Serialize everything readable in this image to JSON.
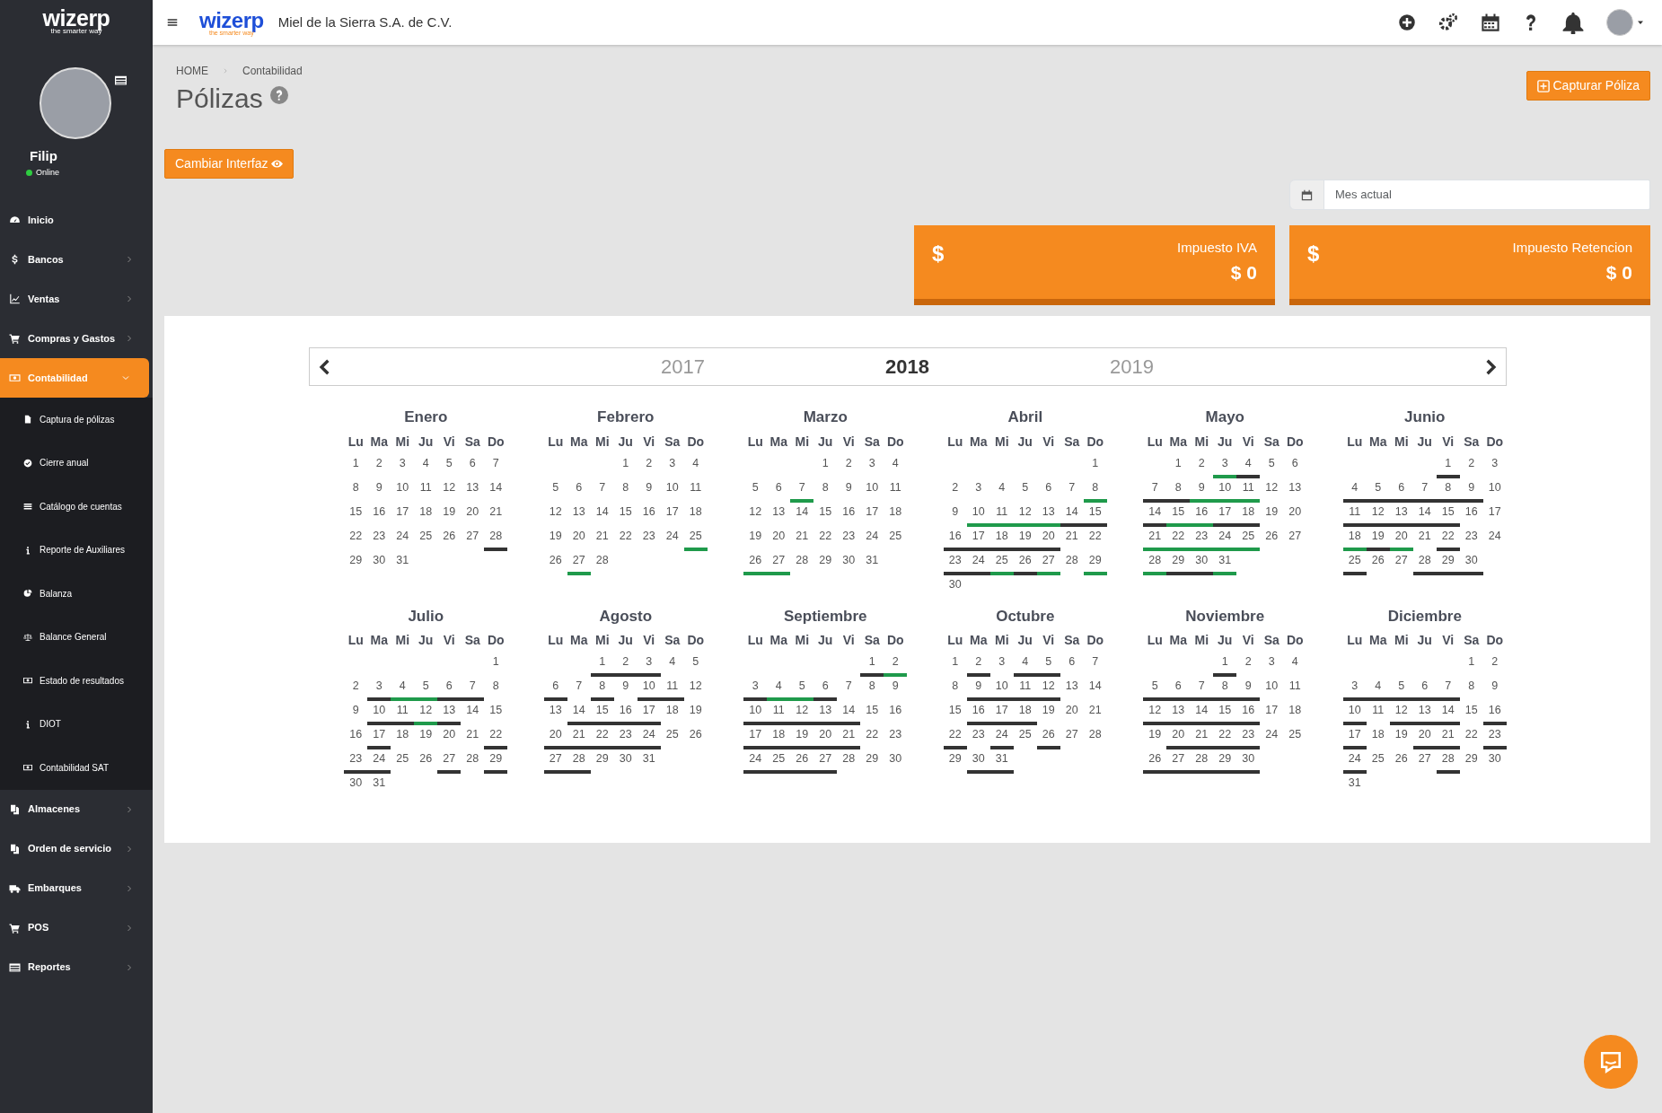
{
  "sidebar": {
    "logo": {
      "name": "wizerp",
      "tagline": "the smarter way"
    },
    "user": {
      "name": "Filip",
      "status": "Online"
    },
    "items": [
      {
        "label": "Inicio",
        "expandable": false,
        "selected": false
      },
      {
        "label": "Bancos",
        "expandable": true,
        "expanded": false,
        "selected": false
      },
      {
        "label": "Ventas",
        "expandable": true,
        "expanded": false,
        "selected": false
      },
      {
        "label": "Compras y Gastos",
        "expandable": true,
        "expanded": false,
        "selected": false
      },
      {
        "label": "Contabilidad",
        "expandable": true,
        "expanded": true,
        "selected": true,
        "children": [
          {
            "label": "Captura de pólizas"
          },
          {
            "label": "Cierre anual"
          },
          {
            "label": "Catálogo de cuentas"
          },
          {
            "label": "Reporte de Auxiliares"
          },
          {
            "label": "Balanza"
          },
          {
            "label": "Balance General"
          },
          {
            "label": "Estado de resultados"
          },
          {
            "label": "DIOT"
          },
          {
            "label": "Contabilidad SAT"
          }
        ]
      },
      {
        "label": "Almacenes",
        "expandable": true,
        "expanded": false,
        "selected": false
      },
      {
        "label": "Orden de servicio",
        "expandable": true,
        "expanded": false,
        "selected": false
      },
      {
        "label": "Embarques",
        "expandable": true,
        "expanded": false,
        "selected": false
      },
      {
        "label": "POS",
        "expandable": true,
        "expanded": false,
        "selected": false
      },
      {
        "label": "Reportes",
        "expandable": true,
        "expanded": false,
        "selected": false
      }
    ]
  },
  "topbar": {
    "logo": {
      "name": "wizerp",
      "tagline": "the smarter way"
    },
    "company": "Miel de la Sierra S.A. de C.V."
  },
  "breadcrumb": [
    "HOME",
    "Contabilidad"
  ],
  "page_title": "Pólizas",
  "buttons": {
    "capture": "Capturar Póliza",
    "switch": "Cambiar Interfaz"
  },
  "period_field": {
    "placeholder": "Mes actual"
  },
  "stats": [
    {
      "symbol": "$",
      "label": "Impuesto IVA",
      "value": "$ 0"
    },
    {
      "symbol": "$",
      "label": "Impuesto Retencion",
      "value": "$ 0"
    }
  ],
  "years": [
    {
      "label": "2017",
      "selected": false
    },
    {
      "label": "2018",
      "selected": true
    },
    {
      "label": "2019",
      "selected": false
    }
  ],
  "months": [
    {
      "name": "Enero",
      "weekdays": [
        "Lu",
        "Ma",
        "Mi",
        "Ju",
        "Vi",
        "Sa",
        "Do"
      ],
      "weeks": [
        [
          {
            "day": "1"
          },
          {
            "day": "2"
          },
          {
            "day": "3"
          },
          {
            "day": "4"
          },
          {
            "day": "5"
          },
          {
            "day": "6"
          },
          {
            "day": "7"
          }
        ],
        [
          {
            "day": "8"
          },
          {
            "day": "9"
          },
          {
            "day": "10"
          },
          {
            "day": "11"
          },
          {
            "day": "12"
          },
          {
            "day": "13"
          },
          {
            "day": "14"
          }
        ],
        [
          {
            "day": "15"
          },
          {
            "day": "16"
          },
          {
            "day": "17"
          },
          {
            "day": "18"
          },
          {
            "day": "19"
          },
          {
            "day": "20"
          },
          {
            "day": "21"
          }
        ],
        [
          {
            "day": "22"
          },
          {
            "day": "23"
          },
          {
            "day": "24"
          },
          {
            "day": "25"
          },
          {
            "day": "26"
          },
          {
            "day": "27"
          },
          {
            "day": "28",
            "color": "#333333"
          }
        ],
        [
          {
            "day": "29"
          },
          {
            "day": "30"
          },
          {
            "day": "31"
          }
        ]
      ]
    },
    {
      "name": "Febrero",
      "weekdays": [
        "Lu",
        "Ma",
        "Mi",
        "Ju",
        "Vi",
        "Sa",
        "Do"
      ],
      "weeks": [
        [
          {
            "day": "1"
          },
          {
            "day": "2"
          },
          {
            "day": "3"
          },
          {
            "day": "4"
          }
        ],
        [
          {
            "day": "5"
          },
          {
            "day": "6"
          },
          {
            "day": "7"
          },
          {
            "day": "8"
          },
          {
            "day": "9"
          },
          {
            "day": "10"
          },
          {
            "day": "11"
          }
        ],
        [
          {
            "day": "12"
          },
          {
            "day": "13"
          },
          {
            "day": "14"
          },
          {
            "day": "15"
          },
          {
            "day": "16"
          },
          {
            "day": "17"
          },
          {
            "day": "18"
          }
        ],
        [
          {
            "day": "19"
          },
          {
            "day": "20"
          },
          {
            "day": "21"
          },
          {
            "day": "22"
          },
          {
            "day": "23"
          },
          {
            "day": "24"
          },
          {
            "day": "25",
            "color": "#1f9a4b"
          }
        ],
        [
          {
            "day": "26"
          },
          {
            "day": "27",
            "color": "#1f9a4b"
          },
          {
            "day": "28"
          }
        ]
      ]
    },
    {
      "name": "Marzo",
      "weekdays": [
        "Lu",
        "Ma",
        "Mi",
        "Ju",
        "Vi",
        "Sa",
        "Do"
      ],
      "weeks": [
        [
          {
            "day": "1"
          },
          {
            "day": "2"
          },
          {
            "day": "3"
          },
          {
            "day": "4"
          }
        ],
        [
          {
            "day": "5"
          },
          {
            "day": "6"
          },
          {
            "day": "7",
            "color": "#1f9a4b"
          },
          {
            "day": "8"
          },
          {
            "day": "9"
          },
          {
            "day": "10"
          },
          {
            "day": "11"
          }
        ],
        [
          {
            "day": "12"
          },
          {
            "day": "13"
          },
          {
            "day": "14"
          },
          {
            "day": "15"
          },
          {
            "day": "16"
          },
          {
            "day": "17"
          },
          {
            "day": "18"
          }
        ],
        [
          {
            "day": "19"
          },
          {
            "day": "20"
          },
          {
            "day": "21"
          },
          {
            "day": "22"
          },
          {
            "day": "23"
          },
          {
            "day": "24"
          },
          {
            "day": "25"
          }
        ],
        [
          {
            "day": "26",
            "color": "#1f9a4b"
          },
          {
            "day": "27",
            "color": "#1f9a4b"
          },
          {
            "day": "28"
          },
          {
            "day": "29"
          },
          {
            "day": "30"
          },
          {
            "day": "31"
          }
        ]
      ]
    },
    {
      "name": "Abril",
      "weekdays": [
        "Lu",
        "Ma",
        "Mi",
        "Ju",
        "Vi",
        "Sa",
        "Do"
      ],
      "weeks": [
        [
          {
            "day": "1"
          }
        ],
        [
          {
            "day": "2"
          },
          {
            "day": "3"
          },
          {
            "day": "4"
          },
          {
            "day": "5"
          },
          {
            "day": "6"
          },
          {
            "day": "7"
          },
          {
            "day": "8",
            "color": "#1f9a4b"
          }
        ],
        [
          {
            "day": "9"
          },
          {
            "day": "10",
            "color": "#1f9a4b"
          },
          {
            "day": "11",
            "color": "#1f9a4b"
          },
          {
            "day": "12",
            "color": "#1f9a4b"
          },
          {
            "day": "13",
            "color": "#1f9a4b"
          },
          {
            "day": "14",
            "color": "#333333"
          },
          {
            "day": "15",
            "color": "#333333"
          }
        ],
        [
          {
            "day": "16",
            "color": "#333333"
          },
          {
            "day": "17",
            "color": "#333333"
          },
          {
            "day": "18",
            "color": "#333333"
          },
          {
            "day": "19",
            "color": "#333333"
          },
          {
            "day": "20",
            "color": "#333333"
          },
          {
            "day": "21"
          },
          {
            "day": "22"
          }
        ],
        [
          {
            "day": "23",
            "color": "#333333"
          },
          {
            "day": "24",
            "color": "#333333"
          },
          {
            "day": "25",
            "color": "#1f9a4b"
          },
          {
            "day": "26",
            "color": "#333333"
          },
          {
            "day": "27",
            "color": "#1f9a4b"
          },
          {
            "day": "28"
          },
          {
            "day": "29",
            "color": "#1f9a4b"
          }
        ],
        [
          {
            "day": "30"
          }
        ]
      ]
    },
    {
      "name": "Mayo",
      "weekdays": [
        "Lu",
        "Ma",
        "Mi",
        "Ju",
        "Vi",
        "Sa",
        "Do"
      ],
      "weeks": [
        [
          {
            "day": "1"
          },
          {
            "day": "2"
          },
          {
            "day": "3",
            "color": "#1f9a4b"
          },
          {
            "day": "4",
            "color": "#333333"
          },
          {
            "day": "5"
          },
          {
            "day": "6"
          }
        ],
        [
          {
            "day": "7",
            "color": "#333333"
          },
          {
            "day": "8",
            "color": "#333333"
          },
          {
            "day": "9",
            "color": "#1f9a4b"
          },
          {
            "day": "10",
            "color": "#1f9a4b"
          },
          {
            "day": "11",
            "color": "#1f9a4b"
          },
          {
            "day": "12"
          },
          {
            "day": "13"
          }
        ],
        [
          {
            "day": "14",
            "color": "#333333"
          },
          {
            "day": "15",
            "color": "#1f9a4b"
          },
          {
            "day": "16",
            "color": "#1f9a4b"
          },
          {
            "day": "17",
            "color": "#333333"
          },
          {
            "day": "18",
            "color": "#333333"
          },
          {
            "day": "19"
          },
          {
            "day": "20"
          }
        ],
        [
          {
            "day": "21",
            "color": "#1f9a4b"
          },
          {
            "day": "22",
            "color": "#1f9a4b"
          },
          {
            "day": "23",
            "color": "#1f9a4b"
          },
          {
            "day": "24",
            "color": "#1f9a4b"
          },
          {
            "day": "25",
            "color": "#1f9a4b"
          },
          {
            "day": "26"
          },
          {
            "day": "27"
          }
        ],
        [
          {
            "day": "28",
            "color": "#1f9a4b"
          },
          {
            "day": "29",
            "color": "#333333"
          },
          {
            "day": "30",
            "color": "#333333"
          },
          {
            "day": "31",
            "color": "#1f9a4b"
          }
        ]
      ]
    },
    {
      "name": "Junio",
      "weekdays": [
        "Lu",
        "Ma",
        "Mi",
        "Ju",
        "Vi",
        "Sa",
        "Do"
      ],
      "weeks": [
        [
          {
            "day": "1",
            "color": "#333333"
          },
          {
            "day": "2"
          },
          {
            "day": "3"
          }
        ],
        [
          {
            "day": "4",
            "color": "#333333"
          },
          {
            "day": "5",
            "color": "#333333"
          },
          {
            "day": "6",
            "color": "#333333"
          },
          {
            "day": "7",
            "color": "#333333"
          },
          {
            "day": "8",
            "color": "#333333"
          },
          {
            "day": "9",
            "color": "#333333"
          },
          {
            "day": "10"
          }
        ],
        [
          {
            "day": "11",
            "color": "#333333"
          },
          {
            "day": "12",
            "color": "#333333"
          },
          {
            "day": "13",
            "color": "#333333"
          },
          {
            "day": "14",
            "color": "#333333"
          },
          {
            "day": "15",
            "color": "#333333"
          },
          {
            "day": "16"
          },
          {
            "day": "17"
          }
        ],
        [
          {
            "day": "18",
            "color": "#1f9a4b"
          },
          {
            "day": "19",
            "color": "#333333"
          },
          {
            "day": "20",
            "color": "#1f9a4b"
          },
          {
            "day": "21"
          },
          {
            "day": "22",
            "color": "#333333"
          },
          {
            "day": "23"
          },
          {
            "day": "24"
          }
        ],
        [
          {
            "day": "25",
            "color": "#333333"
          },
          {
            "day": "26"
          },
          {
            "day": "27"
          },
          {
            "day": "28",
            "color": "#333333"
          },
          {
            "day": "29",
            "color": "#333333"
          },
          {
            "day": "30",
            "color": "#333333"
          }
        ]
      ]
    },
    {
      "name": "Julio",
      "weekdays": [
        "Lu",
        "Ma",
        "Mi",
        "Ju",
        "Vi",
        "Sa",
        "Do"
      ],
      "weeks": [
        [
          {
            "day": "1"
          }
        ],
        [
          {
            "day": "2"
          },
          {
            "day": "3",
            "color": "#333333"
          },
          {
            "day": "4",
            "color": "#1f9a4b"
          },
          {
            "day": "5",
            "color": "#1f9a4b"
          },
          {
            "day": "6",
            "color": "#333333"
          },
          {
            "day": "7",
            "color": "#333333"
          },
          {
            "day": "8"
          }
        ],
        [
          {
            "day": "9"
          },
          {
            "day": "10",
            "color": "#333333"
          },
          {
            "day": "11",
            "color": "#333333"
          },
          {
            "day": "12",
            "color": "#1f9a4b"
          },
          {
            "day": "13",
            "color": "#333333"
          },
          {
            "day": "14"
          },
          {
            "day": "15"
          }
        ],
        [
          {
            "day": "16"
          },
          {
            "day": "17",
            "color": "#333333"
          },
          {
            "day": "18"
          },
          {
            "day": "19"
          },
          {
            "day": "20"
          },
          {
            "day": "21"
          },
          {
            "day": "22",
            "color": "#333333"
          }
        ],
        [
          {
            "day": "23",
            "color": "#333333"
          },
          {
            "day": "24",
            "color": "#333333"
          },
          {
            "day": "25"
          },
          {
            "day": "26"
          },
          {
            "day": "27",
            "color": "#333333"
          },
          {
            "day": "28"
          },
          {
            "day": "29",
            "color": "#333333"
          }
        ],
        [
          {
            "day": "30"
          },
          {
            "day": "31"
          }
        ]
      ]
    },
    {
      "name": "Agosto",
      "weekdays": [
        "Lu",
        "Ma",
        "Mi",
        "Ju",
        "Vi",
        "Sa",
        "Do"
      ],
      "weeks": [
        [
          {
            "day": "1",
            "color": "#333333"
          },
          {
            "day": "2",
            "color": "#333333"
          },
          {
            "day": "3",
            "color": "#333333"
          },
          {
            "day": "4"
          },
          {
            "day": "5"
          }
        ],
        [
          {
            "day": "6",
            "color": "#333333"
          },
          {
            "day": "7"
          },
          {
            "day": "8",
            "color": "#333333"
          },
          {
            "day": "9"
          },
          {
            "day": "10",
            "color": "#333333"
          },
          {
            "day": "11",
            "color": "#333333"
          },
          {
            "day": "12"
          }
        ],
        [
          {
            "day": "13"
          },
          {
            "day": "14",
            "color": "#333333"
          },
          {
            "day": "15",
            "color": "#333333"
          },
          {
            "day": "16",
            "color": "#333333"
          },
          {
            "day": "17",
            "color": "#333333"
          },
          {
            "day": "18"
          },
          {
            "day": "19"
          }
        ],
        [
          {
            "day": "20",
            "color": "#333333"
          },
          {
            "day": "21",
            "color": "#333333"
          },
          {
            "day": "22",
            "color": "#333333"
          },
          {
            "day": "23",
            "color": "#333333"
          },
          {
            "day": "24",
            "color": "#333333"
          },
          {
            "day": "25"
          },
          {
            "day": "26"
          }
        ],
        [
          {
            "day": "27",
            "color": "#333333"
          },
          {
            "day": "28",
            "color": "#333333"
          },
          {
            "day": "29"
          },
          {
            "day": "30"
          },
          {
            "day": "31"
          }
        ]
      ]
    },
    {
      "name": "Septiembre",
      "weekdays": [
        "Lu",
        "Ma",
        "Mi",
        "Ju",
        "Vi",
        "Sa",
        "Do"
      ],
      "weeks": [
        [
          {
            "day": "1",
            "color": "#333333"
          },
          {
            "day": "2",
            "color": "#1f9a4b"
          }
        ],
        [
          {
            "day": "3",
            "color": "#333333"
          },
          {
            "day": "4",
            "color": "#1f9a4b"
          },
          {
            "day": "5",
            "color": "#1f9a4b"
          },
          {
            "day": "6",
            "color": "#333333"
          },
          {
            "day": "7"
          },
          {
            "day": "8"
          },
          {
            "day": "9"
          }
        ],
        [
          {
            "day": "10",
            "color": "#333333"
          },
          {
            "day": "11",
            "color": "#333333"
          },
          {
            "day": "12",
            "color": "#333333"
          },
          {
            "day": "13",
            "color": "#333333"
          },
          {
            "day": "14",
            "color": "#333333"
          },
          {
            "day": "15"
          },
          {
            "day": "16"
          }
        ],
        [
          {
            "day": "17",
            "color": "#333333"
          },
          {
            "day": "18",
            "color": "#333333"
          },
          {
            "day": "19",
            "color": "#333333"
          },
          {
            "day": "20",
            "color": "#333333"
          },
          {
            "day": "21",
            "color": "#333333"
          },
          {
            "day": "22"
          },
          {
            "day": "23"
          }
        ],
        [
          {
            "day": "24",
            "color": "#333333"
          },
          {
            "day": "25",
            "color": "#333333"
          },
          {
            "day": "26",
            "color": "#333333"
          },
          {
            "day": "27",
            "color": "#333333"
          },
          {
            "day": "28"
          },
          {
            "day": "29"
          },
          {
            "day": "30"
          }
        ]
      ]
    },
    {
      "name": "Octubre",
      "weekdays": [
        "Lu",
        "Ma",
        "Mi",
        "Ju",
        "Vi",
        "Sa",
        "Do"
      ],
      "weeks": [
        [
          {
            "day": "1"
          },
          {
            "day": "2",
            "color": "#333333"
          },
          {
            "day": "3"
          },
          {
            "day": "4",
            "color": "#333333"
          },
          {
            "day": "5",
            "color": "#333333"
          },
          {
            "day": "6"
          },
          {
            "day": "7"
          }
        ],
        [
          {
            "day": "8"
          },
          {
            "day": "9",
            "color": "#333333"
          },
          {
            "day": "10",
            "color": "#333333"
          },
          {
            "day": "11",
            "color": "#333333"
          },
          {
            "day": "12",
            "color": "#333333"
          },
          {
            "day": "13"
          },
          {
            "day": "14"
          }
        ],
        [
          {
            "day": "15"
          },
          {
            "day": "16",
            "color": "#333333"
          },
          {
            "day": "17",
            "color": "#333333"
          },
          {
            "day": "18",
            "color": "#333333"
          },
          {
            "day": "19"
          },
          {
            "day": "20"
          },
          {
            "day": "21"
          }
        ],
        [
          {
            "day": "22",
            "color": "#333333"
          },
          {
            "day": "23"
          },
          {
            "day": "24",
            "color": "#333333"
          },
          {
            "day": "25"
          },
          {
            "day": "26",
            "color": "#333333"
          },
          {
            "day": "27"
          },
          {
            "day": "28"
          }
        ],
        [
          {
            "day": "29"
          },
          {
            "day": "30",
            "color": "#333333"
          },
          {
            "day": "31",
            "color": "#333333"
          }
        ]
      ]
    },
    {
      "name": "Noviembre",
      "weekdays": [
        "Lu",
        "Ma",
        "Mi",
        "Ju",
        "Vi",
        "Sa",
        "Do"
      ],
      "weeks": [
        [
          {
            "day": "1",
            "color": "#333333"
          },
          {
            "day": "2"
          },
          {
            "day": "3"
          },
          {
            "day": "4"
          }
        ],
        [
          {
            "day": "5",
            "color": "#333333"
          },
          {
            "day": "6",
            "color": "#333333"
          },
          {
            "day": "7",
            "color": "#333333"
          },
          {
            "day": "8",
            "color": "#333333"
          },
          {
            "day": "9",
            "color": "#333333"
          },
          {
            "day": "10"
          },
          {
            "day": "11"
          }
        ],
        [
          {
            "day": "12",
            "color": "#333333"
          },
          {
            "day": "13",
            "color": "#333333"
          },
          {
            "day": "14",
            "color": "#333333"
          },
          {
            "day": "15",
            "color": "#333333"
          },
          {
            "day": "16",
            "color": "#333333"
          },
          {
            "day": "17"
          },
          {
            "day": "18"
          }
        ],
        [
          {
            "day": "19"
          },
          {
            "day": "20",
            "color": "#333333"
          },
          {
            "day": "21",
            "color": "#333333"
          },
          {
            "day": "22",
            "color": "#333333"
          },
          {
            "day": "23",
            "color": "#333333"
          },
          {
            "day": "24"
          },
          {
            "day": "25"
          }
        ],
        [
          {
            "day": "26",
            "color": "#333333"
          },
          {
            "day": "27",
            "color": "#333333"
          },
          {
            "day": "28",
            "color": "#333333"
          },
          {
            "day": "29",
            "color": "#333333"
          },
          {
            "day": "30",
            "color": "#333333"
          }
        ]
      ]
    },
    {
      "name": "Diciembre",
      "weekdays": [
        "Lu",
        "Ma",
        "Mi",
        "Ju",
        "Vi",
        "Sa",
        "Do"
      ],
      "weeks": [
        [
          {
            "day": "1"
          },
          {
            "day": "2"
          }
        ],
        [
          {
            "day": "3",
            "color": "#333333"
          },
          {
            "day": "4",
            "color": "#333333"
          },
          {
            "day": "5",
            "color": "#333333"
          },
          {
            "day": "6",
            "color": "#333333"
          },
          {
            "day": "7",
            "color": "#333333"
          },
          {
            "day": "8"
          },
          {
            "day": "9"
          }
        ],
        [
          {
            "day": "10",
            "color": "#333333"
          },
          {
            "day": "11"
          },
          {
            "day": "12",
            "color": "#333333"
          },
          {
            "day": "13",
            "color": "#333333"
          },
          {
            "day": "14",
            "color": "#333333"
          },
          {
            "day": "15"
          },
          {
            "day": "16",
            "color": "#333333"
          }
        ],
        [
          {
            "day": "17",
            "color": "#333333"
          },
          {
            "day": "18"
          },
          {
            "day": "19"
          },
          {
            "day": "20",
            "color": "#333333"
          },
          {
            "day": "21",
            "color": "#333333"
          },
          {
            "day": "22"
          },
          {
            "day": "23",
            "color": "#333333"
          }
        ],
        [
          {
            "day": "24",
            "color": "#333333"
          },
          {
            "day": "25"
          },
          {
            "day": "26"
          },
          {
            "day": "27"
          },
          {
            "day": "28",
            "color": "#333333"
          },
          {
            "day": "29"
          },
          {
            "day": "30"
          }
        ],
        [
          {
            "day": "31"
          }
        ]
      ]
    }
  ]
}
